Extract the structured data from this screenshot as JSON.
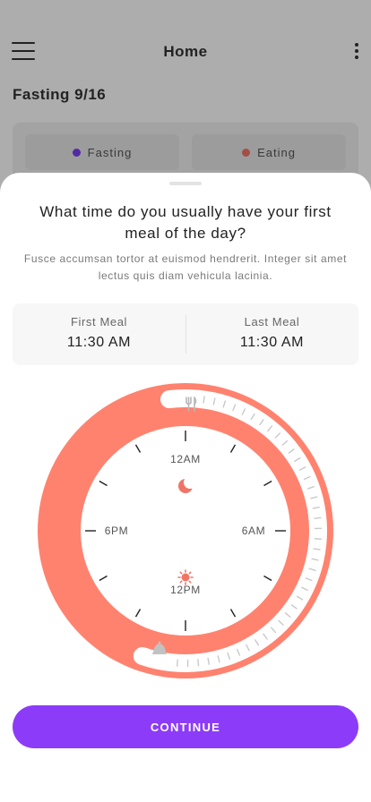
{
  "app": {
    "title": "Home",
    "plan": "Fasting 9/16",
    "legend": [
      {
        "label": "Fasting",
        "color": "#7b3ff2"
      },
      {
        "label": "Eating",
        "color": "#f07466"
      }
    ]
  },
  "sheet": {
    "question": "What time do you usually have your first meal of the day?",
    "subtitle": "Fusce accumsan tortor at euismod hendrerit. Integer sit amet lectus quis diam vehicula lacinia.",
    "first_meal": {
      "label": "First Meal",
      "value": "11:30 AM"
    },
    "last_meal": {
      "label": "Last Meal",
      "value": "11:30 AM"
    },
    "clock_labels": {
      "top": "12AM",
      "right": "6AM",
      "bottom": "12PM",
      "left": "6PM"
    },
    "continue_label": "CONTINUE"
  },
  "icons": {
    "menu": "hamburger-icon",
    "more": "more-vertical-icon",
    "night": "moon-icon",
    "day": "sun-icon",
    "meal_start": "fork-knife-icon",
    "meal_end": "bell-icon"
  },
  "colors": {
    "accent": "#8c3cf8",
    "ring": "#ff826f",
    "fasting": "#7b3ff2",
    "eating": "#f07466"
  }
}
